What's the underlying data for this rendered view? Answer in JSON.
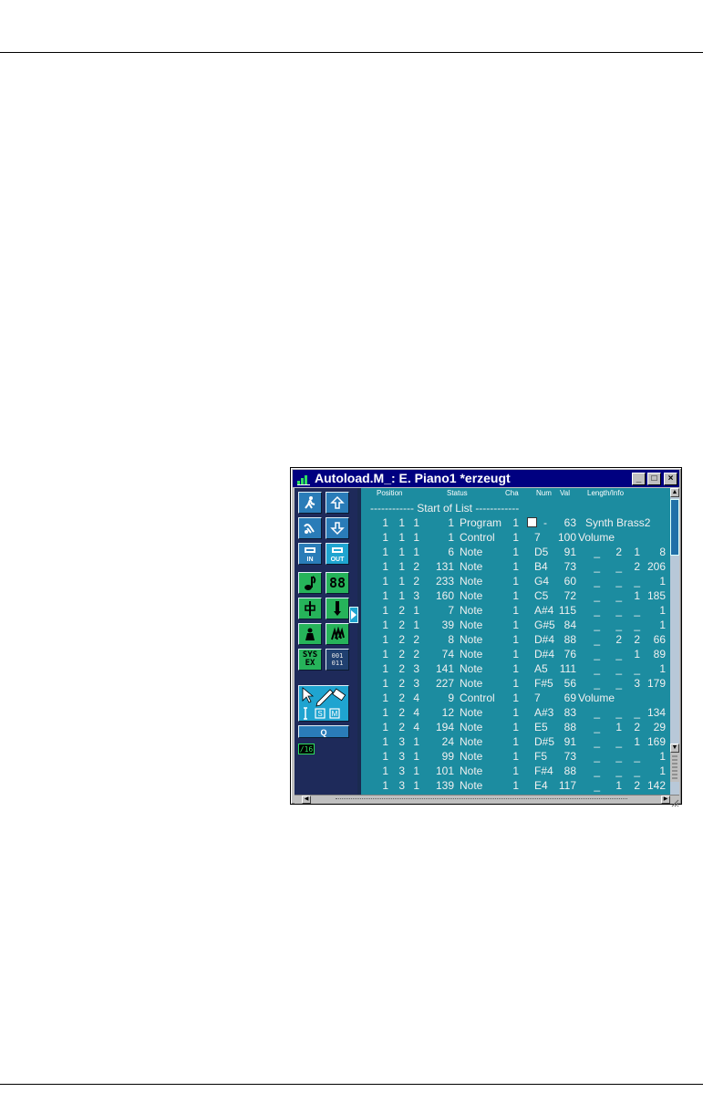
{
  "window": {
    "title": "Autoload.M_: E. Piano1 *erzeugt",
    "controls": {
      "minimize": "_",
      "maximize": "□",
      "close": "×"
    }
  },
  "toolbar": {
    "tools": [
      {
        "name": "walk-icon"
      },
      {
        "name": "up-arrow-icon"
      },
      {
        "name": "pencil-hand-icon"
      },
      {
        "name": "down-arrow-icon"
      },
      {
        "name": "midi-in-icon",
        "label": "IN"
      },
      {
        "name": "midi-out-icon",
        "label": "OUT"
      },
      {
        "name": "note-icon"
      },
      {
        "name": "lcd-88-icon",
        "label": "88"
      },
      {
        "name": "pitch-up-icon"
      },
      {
        "name": "pitch-down-icon"
      },
      {
        "name": "weight-icon"
      },
      {
        "name": "chord-icon"
      },
      {
        "name": "sysex-icon",
        "label": "SYS\nEX"
      },
      {
        "name": "binary-icon",
        "label": "001\n011"
      }
    ],
    "quantize_label": "Q",
    "quantize_value": "/16"
  },
  "list": {
    "columns": {
      "position": "Position",
      "status": "Status",
      "cha": "Cha",
      "num": "Num",
      "val": "Val",
      "length": "Length/Info"
    },
    "start_marker": "------------ Start of List ------------",
    "rows": [
      {
        "p1": "1",
        "p2": "1",
        "p3": "1",
        "p4": "1",
        "status": "Program",
        "cha": "1",
        "num": "-",
        "val": "63",
        "info": "Synth Brass2",
        "checkbox": true
      },
      {
        "p1": "1",
        "p2": "1",
        "p3": "1",
        "p4": "1",
        "status": "Control",
        "cha": "1",
        "num": "7",
        "val": "100",
        "info": "Volume"
      },
      {
        "p1": "1",
        "p2": "1",
        "p3": "1",
        "p4": "6",
        "status": "Note",
        "cha": "1",
        "num": "D5",
        "val": "91",
        "l1": "_",
        "l2": "2",
        "l3": "1",
        "l4": "8"
      },
      {
        "p1": "1",
        "p2": "1",
        "p3": "2",
        "p4": "131",
        "status": "Note",
        "cha": "1",
        "num": "B4",
        "val": "73",
        "l1": "_",
        "l2": "_",
        "l3": "2",
        "l4": "206"
      },
      {
        "p1": "1",
        "p2": "1",
        "p3": "2",
        "p4": "233",
        "status": "Note",
        "cha": "1",
        "num": "G4",
        "val": "60",
        "l1": "_",
        "l2": "_",
        "l3": "_",
        "l4": "1"
      },
      {
        "p1": "1",
        "p2": "1",
        "p3": "3",
        "p4": "160",
        "status": "Note",
        "cha": "1",
        "num": "C5",
        "val": "72",
        "l1": "_",
        "l2": "_",
        "l3": "1",
        "l4": "185"
      },
      {
        "p1": "1",
        "p2": "2",
        "p3": "1",
        "p4": "7",
        "status": "Note",
        "cha": "1",
        "num": "A#4",
        "val": "115",
        "l1": "_",
        "l2": "_",
        "l3": "_",
        "l4": "1"
      },
      {
        "p1": "1",
        "p2": "2",
        "p3": "1",
        "p4": "39",
        "status": "Note",
        "cha": "1",
        "num": "G#5",
        "val": "84",
        "l1": "_",
        "l2": "_",
        "l3": "_",
        "l4": "1"
      },
      {
        "p1": "1",
        "p2": "2",
        "p3": "2",
        "p4": "8",
        "status": "Note",
        "cha": "1",
        "num": "D#4",
        "val": "88",
        "l1": "_",
        "l2": "2",
        "l3": "2",
        "l4": "66"
      },
      {
        "p1": "1",
        "p2": "2",
        "p3": "2",
        "p4": "74",
        "status": "Note",
        "cha": "1",
        "num": "D#4",
        "val": "76",
        "l1": "_",
        "l2": "_",
        "l3": "1",
        "l4": "89"
      },
      {
        "p1": "1",
        "p2": "2",
        "p3": "3",
        "p4": "141",
        "status": "Note",
        "cha": "1",
        "num": "A5",
        "val": "111",
        "l1": "_",
        "l2": "_",
        "l3": "_",
        "l4": "1"
      },
      {
        "p1": "1",
        "p2": "2",
        "p3": "3",
        "p4": "227",
        "status": "Note",
        "cha": "1",
        "num": "F#5",
        "val": "56",
        "l1": "_",
        "l2": "_",
        "l3": "3",
        "l4": "179"
      },
      {
        "p1": "1",
        "p2": "2",
        "p3": "4",
        "p4": "9",
        "status": "Control",
        "cha": "1",
        "num": "7",
        "val": "69",
        "info": "Volume"
      },
      {
        "p1": "1",
        "p2": "2",
        "p3": "4",
        "p4": "12",
        "status": "Note",
        "cha": "1",
        "num": "A#3",
        "val": "83",
        "l1": "_",
        "l2": "_",
        "l3": "_",
        "l4": "134"
      },
      {
        "p1": "1",
        "p2": "2",
        "p3": "4",
        "p4": "194",
        "status": "Note",
        "cha": "1",
        "num": "E5",
        "val": "88",
        "l1": "_",
        "l2": "1",
        "l3": "2",
        "l4": "29"
      },
      {
        "p1": "1",
        "p2": "3",
        "p3": "1",
        "p4": "24",
        "status": "Note",
        "cha": "1",
        "num": "D#5",
        "val": "91",
        "l1": "_",
        "l2": "_",
        "l3": "1",
        "l4": "169"
      },
      {
        "p1": "1",
        "p2": "3",
        "p3": "1",
        "p4": "99",
        "status": "Note",
        "cha": "1",
        "num": "F5",
        "val": "73",
        "l1": "_",
        "l2": "_",
        "l3": "_",
        "l4": "1"
      },
      {
        "p1": "1",
        "p2": "3",
        "p3": "1",
        "p4": "101",
        "status": "Note",
        "cha": "1",
        "num": "F#4",
        "val": "88",
        "l1": "_",
        "l2": "_",
        "l3": "_",
        "l4": "1"
      },
      {
        "p1": "1",
        "p2": "3",
        "p3": "1",
        "p4": "139",
        "status": "Note",
        "cha": "1",
        "num": "E4",
        "val": "117",
        "l1": "_",
        "l2": "1",
        "l3": "2",
        "l4": "142"
      }
    ]
  },
  "colors": {
    "list_bg": "#1c8ca0",
    "titlebar": "#000080",
    "toolbar_bg": "#1e2a5a",
    "tool_green": "#26b35a",
    "tool_blue": "#2a7cb8"
  }
}
